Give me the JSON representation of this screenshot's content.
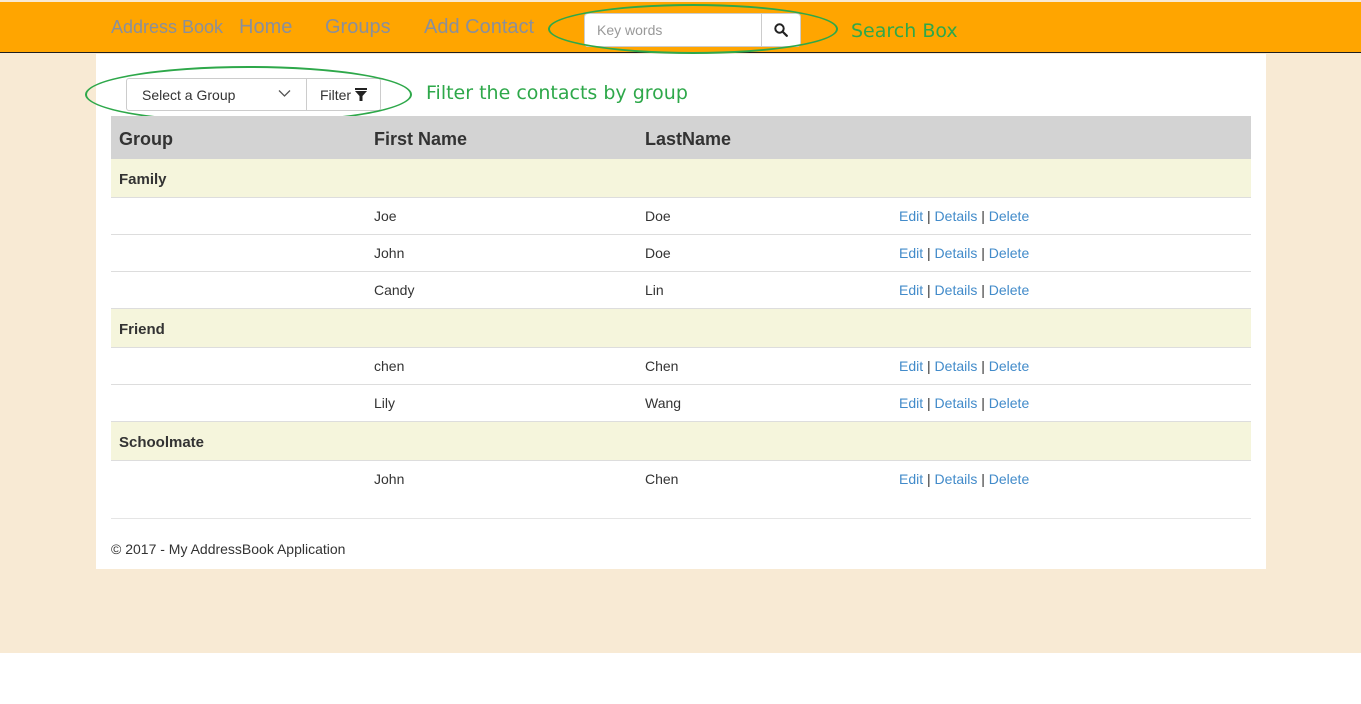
{
  "navbar": {
    "brand": "Address Book",
    "links": [
      "Home",
      "Groups",
      "Add Contact"
    ],
    "search_placeholder": "Key words",
    "search_icon": "search-icon",
    "bg_color": "#ffa500"
  },
  "annotations": {
    "search": "Search Box",
    "filter": "Filter the contacts by group",
    "color": "#2ea84a"
  },
  "filter_bar": {
    "select_label": "Select a Group",
    "filter_label": "Filter",
    "filter_icon": "funnel-icon"
  },
  "table": {
    "headers": [
      "Group",
      "First Name",
      "LastName"
    ],
    "groups": [
      {
        "name": "Family",
        "rows": [
          {
            "first": "Joe",
            "last": "Doe"
          },
          {
            "first": "John",
            "last": "Doe"
          },
          {
            "first": "Candy",
            "last": "Lin"
          }
        ]
      },
      {
        "name": "Friend",
        "rows": [
          {
            "first": "chen",
            "last": "Chen"
          },
          {
            "first": "Lily",
            "last": "Wang"
          }
        ]
      },
      {
        "name": "Schoolmate",
        "rows": [
          {
            "first": "John",
            "last": "Chen"
          }
        ]
      }
    ],
    "actions": [
      "Edit",
      "Details",
      "Delete"
    ],
    "separator": "|"
  },
  "footer": {
    "text": "© 2017 - My AddressBook Application"
  },
  "colors": {
    "page_bg": "#f8ead4",
    "group_row_bg": "#f5f5dc",
    "header_bg": "#d3d3d3",
    "link": "#428bca"
  }
}
